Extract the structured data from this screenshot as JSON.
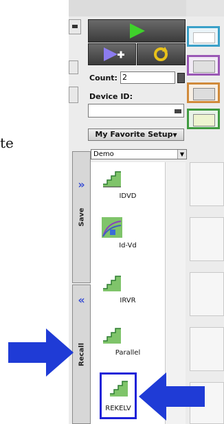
{
  "fragment_text": "te",
  "count": {
    "label": "Count:",
    "value": "2"
  },
  "device": {
    "label": "Device ID:",
    "value": ""
  },
  "favorites": {
    "label": "My Favorite Setup",
    "selected": "Demo"
  },
  "tabs": {
    "save": "Save",
    "recall": "Recall"
  },
  "items": [
    {
      "label": "IDVD",
      "icon": "staircase-icon"
    },
    {
      "label": "Id-Vd",
      "icon": "curve-plot-icon"
    },
    {
      "label": "IRVR",
      "icon": "staircase-icon"
    },
    {
      "label": "Parallel",
      "icon": "staircase-icon"
    },
    {
      "label": "REKELV",
      "icon": "staircase-icon",
      "selected": true
    }
  ],
  "colors": {
    "arrow": "#1f3bd6",
    "tile1": "#3aa0c8",
    "tile2": "#9a58b5",
    "tile3": "#d08a3a",
    "tile4": "#3f9a3f",
    "selection": "#1e22d8"
  }
}
